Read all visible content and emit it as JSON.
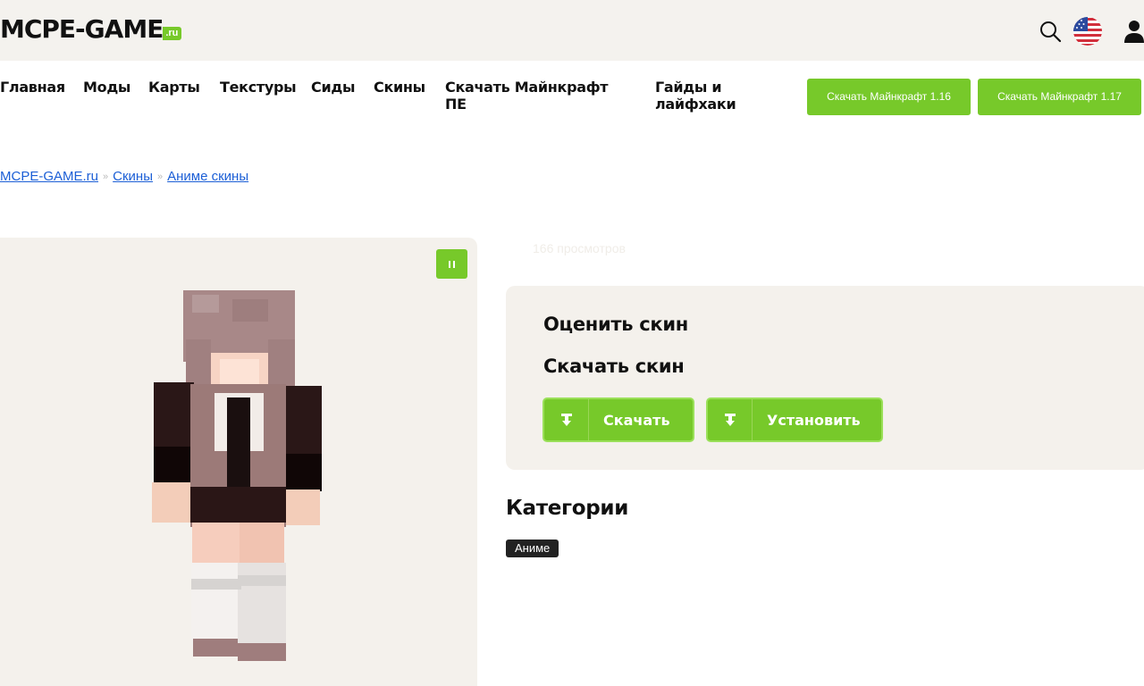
{
  "header": {
    "logo": {
      "main": "MCPE-GAME",
      "suffix": ".ru"
    },
    "icons": [
      "search-icon",
      "us-flag-icon",
      "user-icon"
    ]
  },
  "nav": {
    "items": [
      {
        "label": "Главная"
      },
      {
        "label": "Моды"
      },
      {
        "label": "Карты"
      },
      {
        "label": "Текстуры"
      },
      {
        "label": "Сиды"
      },
      {
        "label": "Скины"
      },
      {
        "label": "Скачать Майнкрафт ПЕ"
      },
      {
        "label": "Гайды и лайфхаки"
      }
    ],
    "buttons": [
      {
        "label": "Скачать Майнкрафт 1.16"
      },
      {
        "label": "Скачать Майнкрафт 1.17"
      }
    ]
  },
  "breadcrumb": {
    "items": [
      "MCPE-GAME.ru",
      "Скины",
      "Аниме скины"
    ],
    "separator": "»"
  },
  "skin_viewer": {
    "state": "playing",
    "icon": "pause-icon"
  },
  "stats": {
    "views": "166 просмотров"
  },
  "actions": {
    "rate_title": "Оценить скин",
    "download_title": "Скачать скин",
    "download_button": "Скачать",
    "install_button": "Установить",
    "button_icon": "download-icon"
  },
  "categories": {
    "title": "Категории",
    "tags": [
      "Аниме"
    ]
  },
  "colors": {
    "accent": "#77c92a",
    "link": "#1c5fd6",
    "panel_bg": "#f4f1ec",
    "header_bg": "#f4f2ee",
    "tag_bg": "#222222"
  }
}
